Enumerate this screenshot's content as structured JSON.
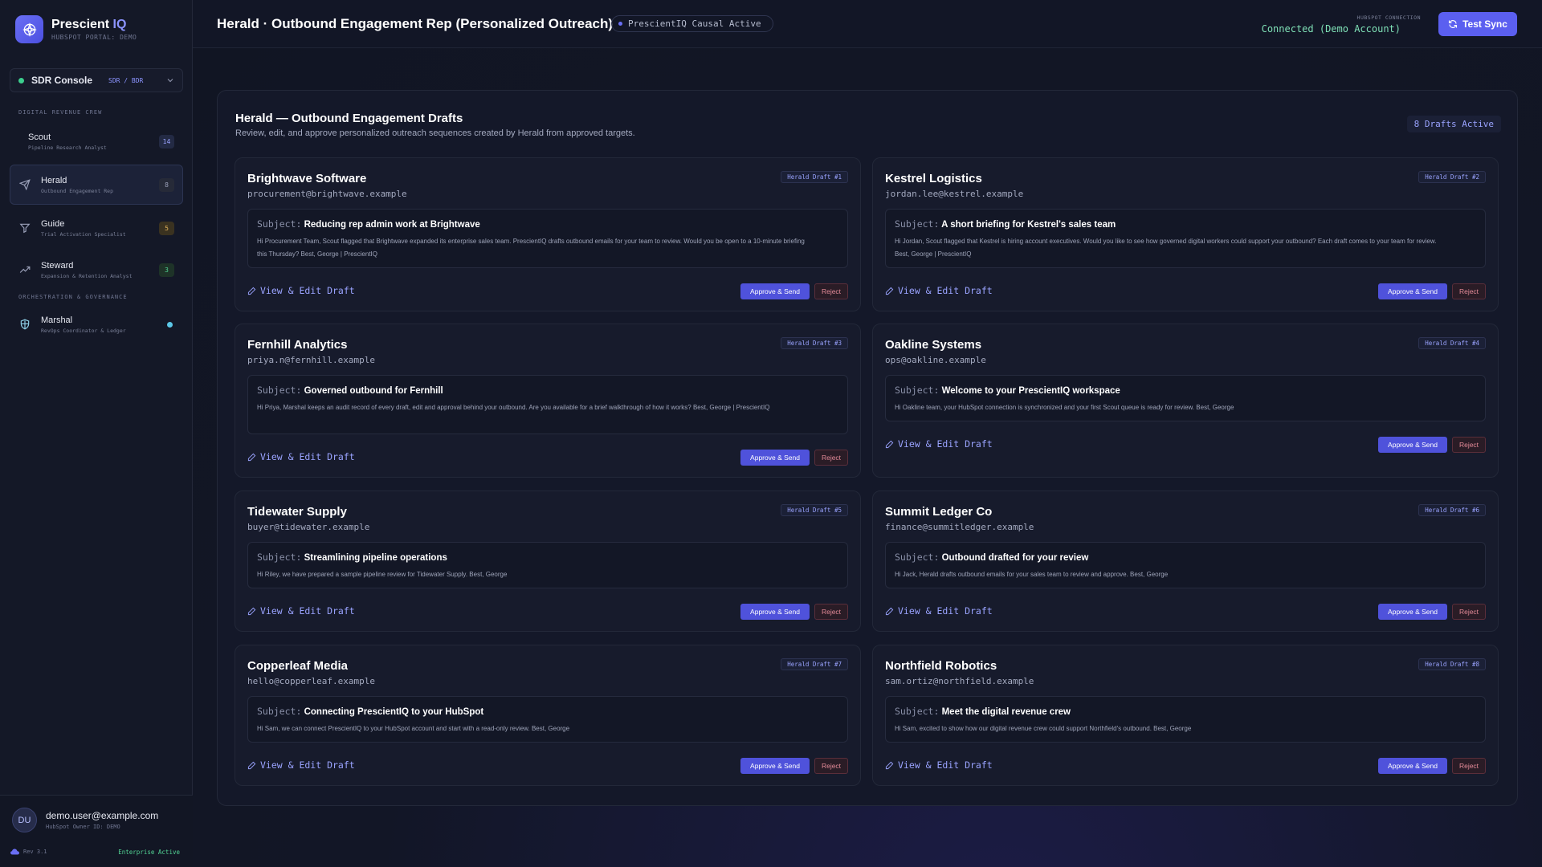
{
  "brand": {
    "name_main": "Prescient",
    "name_accent": "IQ",
    "subtitle": "HUBSPOT PORTAL: DEMO"
  },
  "console": {
    "label": "SDR Console",
    "tag": "SDR / BDR"
  },
  "sidebar": {
    "section1": "DIGITAL REVENUE CREW",
    "section2": "ORCHESTRATION & GOVERNANCE",
    "items": [
      {
        "name": "Scout",
        "sub": "Pipeline Research Analyst",
        "badge": "14",
        "icon": "none"
      },
      {
        "name": "Herald",
        "sub": "Outbound Engagement Rep",
        "badge": "8",
        "icon": "send-icon"
      },
      {
        "name": "Guide",
        "sub": "Trial Activation Specialist",
        "badge": "5",
        "icon": "filter-icon"
      },
      {
        "name": "Steward",
        "sub": "Expansion & Retention Analyst",
        "badge": "3",
        "icon": "trending-up-icon"
      },
      {
        "name": "Marshal",
        "sub": "RevOps Coordinator & Ledger",
        "badge": "",
        "icon": "shield-icon"
      }
    ]
  },
  "user": {
    "initials": "DU",
    "email": "demo.user@example.com",
    "owner_id": "HubSpot Owner ID: DEMO",
    "rev": "Rev 3.1",
    "plan": "Enterprise Active"
  },
  "header": {
    "title": "Herald · Outbound Engagement Rep (Personalized Outreach)",
    "causal": "PrescientIQ Causal Active",
    "conn_label": "HUBSPOT CONNECTION",
    "conn_status": "Connected (Demo Account)",
    "sync_button": "Test Sync"
  },
  "panel": {
    "title": "Herald — Outbound Engagement Drafts",
    "description": "Review, edit, and approve personalized outreach sequences created by Herald from approved targets.",
    "active_count": "8 Drafts Active"
  },
  "labels": {
    "subject": "Subject:",
    "view_edit": "View & Edit Draft",
    "approve": "Approve & Send",
    "reject": "Reject"
  },
  "drafts": [
    {
      "company": "Brightwave Software",
      "email": "procurement@brightwave.example",
      "tag": "Herald Draft #1",
      "subject": "Reducing rep admin work at Brightwave",
      "body": "Hi Procurement Team, Scout flagged that Brightwave expanded its enterprise sales team. PrescientIQ drafts outbound emails for your team to review. Would you be open to a 10-minute briefing this Thursday? Best, George | PrescientIQ"
    },
    {
      "company": "Kestrel Logistics",
      "email": "jordan.lee@kestrel.example",
      "tag": "Herald Draft #2",
      "subject": "A short briefing for Kestrel's sales team",
      "body": "Hi Jordan, Scout flagged that Kestrel is hiring account executives. Would you like to see how governed digital workers could support your outbound? Each draft comes to your team for review. Best, George | PrescientIQ"
    },
    {
      "company": "Fernhill Analytics",
      "email": "priya.n@fernhill.example",
      "tag": "Herald Draft #3",
      "subject": "Governed outbound for Fernhill",
      "body": "Hi Priya, Marshal keeps an audit record of every draft, edit and approval behind your outbound. Are you available for a brief walkthrough of how it works? Best, George | PrescientIQ"
    },
    {
      "company": "Oakline Systems",
      "email": "ops@oakline.example",
      "tag": "Herald Draft #4",
      "subject": "Welcome to your PrescientIQ workspace",
      "body": "Hi Oakline team, your HubSpot connection is synchronized and your first Scout queue is ready for review. Best, George"
    },
    {
      "company": "Tidewater Supply",
      "email": "buyer@tidewater.example",
      "tag": "Herald Draft #5",
      "subject": "Streamlining pipeline operations",
      "body": "Hi Riley, we have prepared a sample pipeline review for Tidewater Supply. Best, George"
    },
    {
      "company": "Summit Ledger Co",
      "email": "finance@summitledger.example",
      "tag": "Herald Draft #6",
      "subject": "Outbound drafted for your review",
      "body": "Hi Jack, Herald drafts outbound emails for your sales team to review and approve. Best, George"
    },
    {
      "company": "Copperleaf Media",
      "email": "hello@copperleaf.example",
      "tag": "Herald Draft #7",
      "subject": "Connecting PrescientIQ to your HubSpot",
      "body": "Hi Sam, we can connect PrescientIQ to your HubSpot account and start with a read-only review. Best, George"
    },
    {
      "company": "Northfield Robotics",
      "email": "sam.ortiz@northfield.example",
      "tag": "Herald Draft #8",
      "subject": "Meet the digital revenue crew",
      "body": "Hi Sam, excited to show how our digital revenue crew could support Northfield's outbound. Best, George"
    }
  ]
}
